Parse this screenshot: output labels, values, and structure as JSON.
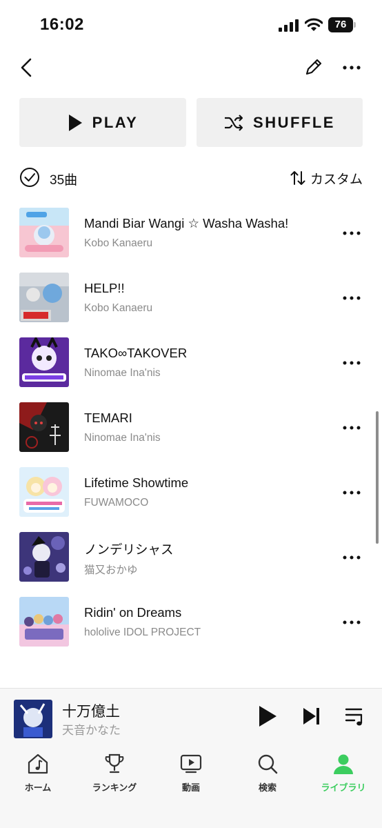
{
  "status_bar": {
    "time": "16:02",
    "battery": "76"
  },
  "header": {
    "play_label": "PLAY",
    "shuffle_label": "SHUFFLE"
  },
  "list_info": {
    "count": "35曲",
    "sort_label": "カスタム"
  },
  "tracks": [
    {
      "title": "Mandi Biar Wangi ☆ Washa Washa!",
      "artist": "Kobo Kanaeru"
    },
    {
      "title": "HELP!!",
      "artist": "Kobo Kanaeru"
    },
    {
      "title": "TAKO∞TAKOVER",
      "artist": "Ninomae Ina'nis"
    },
    {
      "title": "TEMARI",
      "artist": "Ninomae Ina'nis"
    },
    {
      "title": "Lifetime Showtime",
      "artist": "FUWAMOCO"
    },
    {
      "title": "ノンデリシャス",
      "artist": "猫又おかゆ"
    },
    {
      "title": "Ridin' on Dreams",
      "artist": "hololive IDOL PROJECT"
    }
  ],
  "now_playing": {
    "title": "十万億土",
    "artist": "天音かなた"
  },
  "tabs": [
    {
      "label": "ホーム",
      "icon": "home-note-icon"
    },
    {
      "label": "ランキング",
      "icon": "trophy-icon"
    },
    {
      "label": "動画",
      "icon": "video-icon"
    },
    {
      "label": "検索",
      "icon": "search-icon"
    },
    {
      "label": "ライブラリ",
      "icon": "profile-icon"
    }
  ],
  "colors": {
    "accent": "#3ccd5f",
    "button_bg": "#f0f0f0",
    "secondary_text": "#8a8a8a"
  }
}
